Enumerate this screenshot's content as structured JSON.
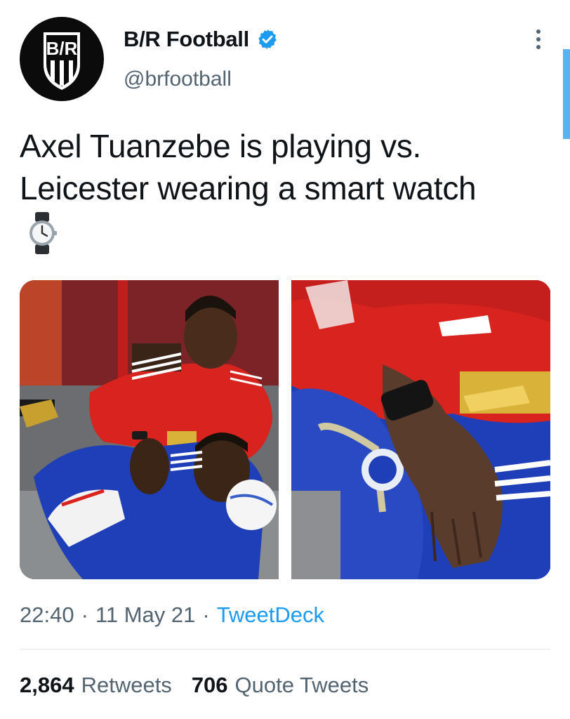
{
  "account": {
    "display_name": "B/R Football",
    "handle": "@brfootball",
    "verified": true,
    "logo_text": "B/R"
  },
  "tweet": {
    "text": "Axel Tuanzebe is playing vs. Leicester wearing a smart watch",
    "emoji": "watch-emoji",
    "time": "22:40",
    "date": "11 May 21",
    "source": "TweetDeck",
    "separator": "·"
  },
  "stats": {
    "retweets_count": "2,864",
    "retweets_label": "Retweets",
    "quote_count": "706",
    "quote_label": "Quote Tweets"
  },
  "colors": {
    "accent": "#1d9bf0",
    "text": "#0f1419",
    "muted": "#536471",
    "man_utd_red": "#d8231f",
    "leicester_blue": "#1f3fb8"
  }
}
